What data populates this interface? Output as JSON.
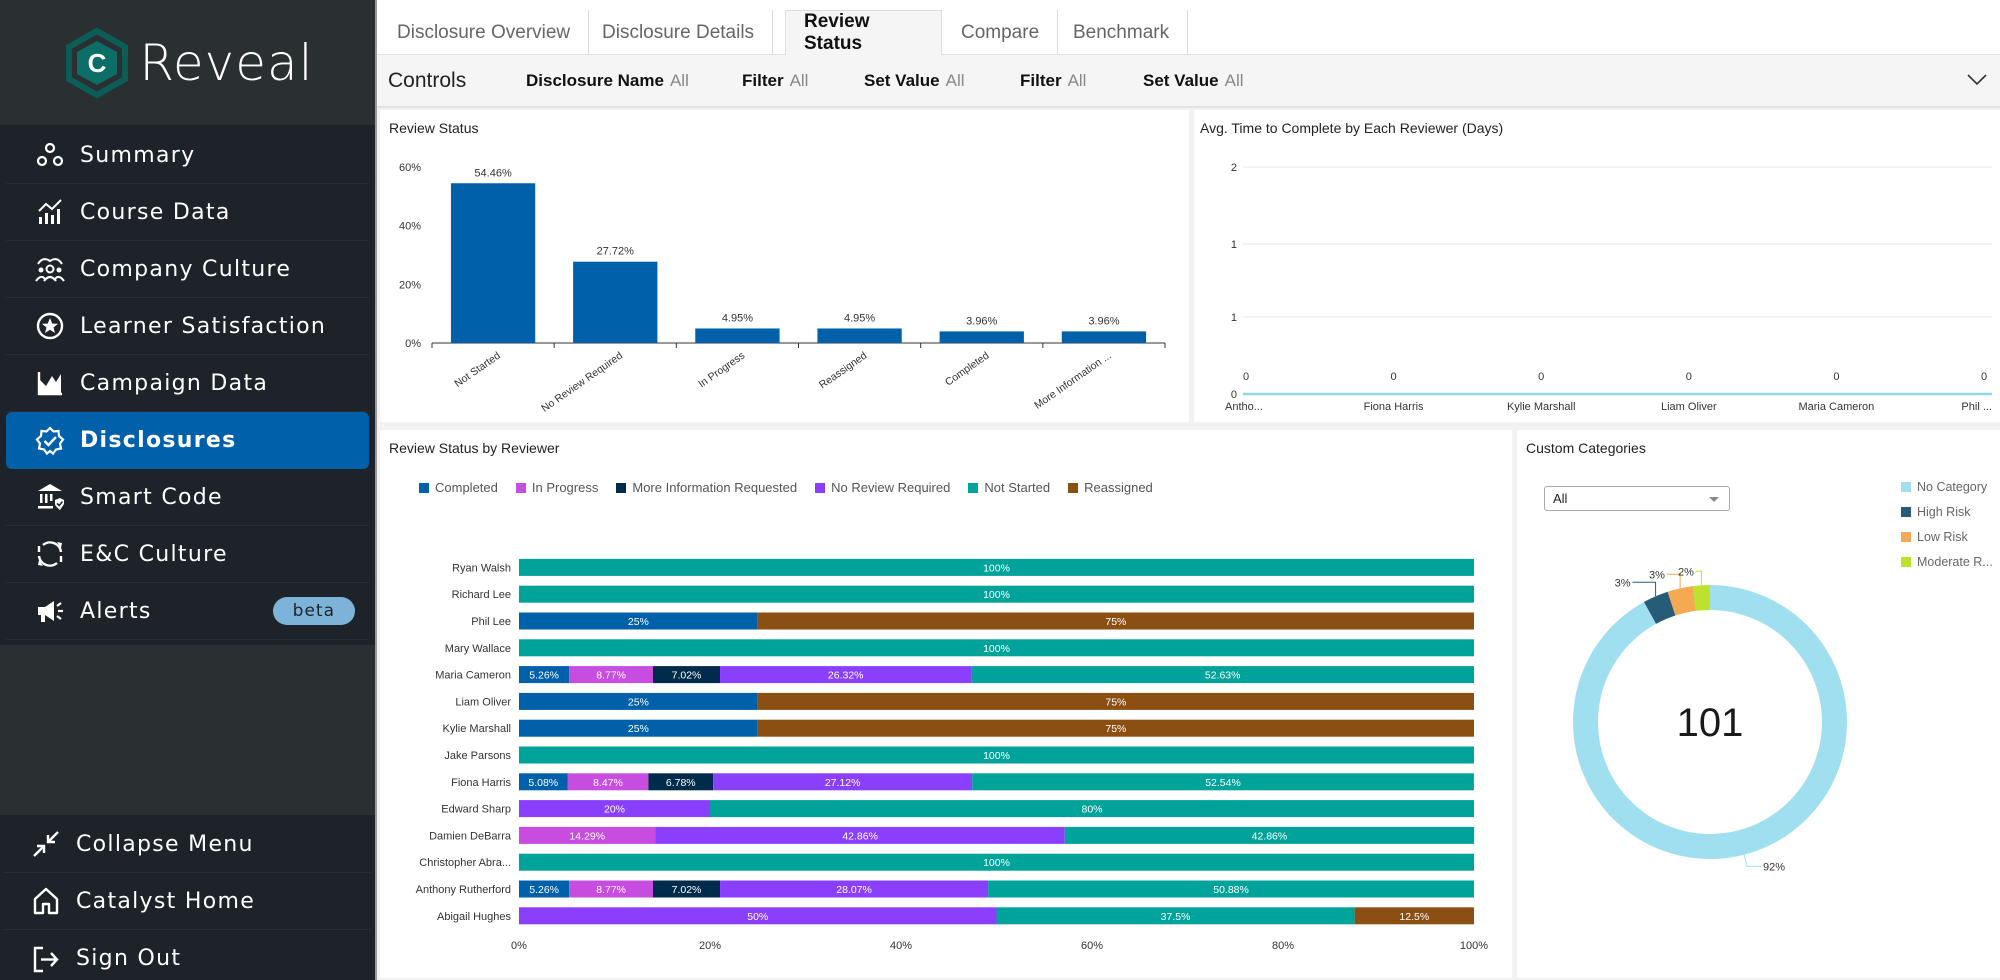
{
  "brand": {
    "logo_letter": "C",
    "name": "Reveal"
  },
  "sidebar": {
    "items": [
      {
        "label": "Summary",
        "icon": "circles-icon"
      },
      {
        "label": "Course Data",
        "icon": "bar-trend-icon"
      },
      {
        "label": "Company Culture",
        "icon": "people-group-icon"
      },
      {
        "label": "Learner Satisfaction",
        "icon": "star-circle-icon"
      },
      {
        "label": "Campaign Data",
        "icon": "area-chart-icon"
      },
      {
        "label": "Disclosures",
        "icon": "badge-check-icon",
        "active": true
      },
      {
        "label": "Smart Code",
        "icon": "bank-shield-icon"
      },
      {
        "label": "E&C Culture",
        "icon": "cycle-arrows-icon"
      },
      {
        "label": "Alerts",
        "icon": "megaphone-icon",
        "badge": "beta"
      }
    ],
    "bottom": [
      {
        "label": "Collapse Menu",
        "icon": "collapse-arrows-icon"
      },
      {
        "label": "Catalyst Home",
        "icon": "home-icon"
      },
      {
        "label": "Sign Out",
        "icon": "sign-out-icon"
      }
    ],
    "active_color": "#0060a9"
  },
  "tabs": [
    {
      "label": "Disclosure Overview"
    },
    {
      "label": "Disclosure Details"
    },
    {
      "label": "Review Status",
      "active": true
    },
    {
      "label": "Compare"
    },
    {
      "label": "Benchmark"
    }
  ],
  "controls": {
    "title": "Controls",
    "filters": [
      {
        "label": "Disclosure Name",
        "value": "All"
      },
      {
        "label": "Filter",
        "value": "All"
      },
      {
        "label": "Set Value",
        "value": "All"
      },
      {
        "label": "Filter",
        "value": "All"
      },
      {
        "label": "Set Value",
        "value": "All"
      }
    ]
  },
  "chart_data": [
    {
      "type": "bar",
      "title": "Review Status",
      "categories": [
        "Not Started",
        "No Review Required",
        "In Progress",
        "Reassigned",
        "Completed",
        "More Information ..."
      ],
      "values": [
        54.46,
        27.72,
        4.95,
        4.95,
        3.96,
        3.96
      ],
      "data_labels": [
        "54.46%",
        "27.72%",
        "4.95%",
        "4.95%",
        "3.96%",
        "3.96%"
      ],
      "yticks": [
        "0%",
        "20%",
        "40%",
        "60%"
      ],
      "ylim": [
        0,
        60
      ],
      "color": "#0060a9",
      "xlabel": "",
      "ylabel": ""
    },
    {
      "type": "line",
      "title": "Avg. Time to Complete by Each Reviewer (Days)",
      "categories": [
        "Antho...",
        "Fiona Harris",
        "Kylie Marshall",
        "Liam Oliver",
        "Maria Cameron",
        "Phil ..."
      ],
      "values": [
        0,
        0,
        0,
        0,
        0,
        0
      ],
      "data_labels": [
        "0",
        "0",
        "0",
        "0",
        "0",
        "0"
      ],
      "yticks": [
        "0",
        "1",
        "1",
        "2"
      ],
      "ylim": [
        0,
        2
      ],
      "color": "#8fd8e8",
      "grid": true
    },
    {
      "type": "bar",
      "orientation": "horizontal-stacked-100",
      "title": "Review Status by Reviewer",
      "legend": [
        {
          "name": "Completed",
          "color": "#0060a9"
        },
        {
          "name": "In Progress",
          "color": "#c74ce0"
        },
        {
          "name": "More Information Requested",
          "color": "#002b4a"
        },
        {
          "name": "No Review Required",
          "color": "#8a3ffc"
        },
        {
          "name": "Not Started",
          "color": "#00a39a"
        },
        {
          "name": "Reassigned",
          "color": "#8b4f12"
        }
      ],
      "legend_placement": "top",
      "xticks": [
        "0%",
        "20%",
        "40%",
        "60%",
        "80%",
        "100%"
      ],
      "xlim": [
        0,
        100
      ],
      "rows": [
        {
          "name": "Ryan Walsh",
          "segments": [
            {
              "series": "Not Started",
              "value": 100,
              "label": "100%"
            }
          ]
        },
        {
          "name": "Richard Lee",
          "segments": [
            {
              "series": "Not Started",
              "value": 100,
              "label": "100%"
            }
          ]
        },
        {
          "name": "Phil Lee",
          "segments": [
            {
              "series": "Completed",
              "value": 25,
              "label": "25%"
            },
            {
              "series": "Reassigned",
              "value": 75,
              "label": "75%"
            }
          ]
        },
        {
          "name": "Mary Wallace",
          "segments": [
            {
              "series": "Not Started",
              "value": 100,
              "label": "100%"
            }
          ]
        },
        {
          "name": "Maria Cameron",
          "segments": [
            {
              "series": "Completed",
              "value": 5.26,
              "label": "5.26%"
            },
            {
              "series": "In Progress",
              "value": 8.77,
              "label": "8.77%"
            },
            {
              "series": "More Information Requested",
              "value": 7.02,
              "label": "7.02%"
            },
            {
              "series": "No Review Required",
              "value": 26.32,
              "label": "26.32%"
            },
            {
              "series": "Not Started",
              "value": 52.63,
              "label": "52.63%"
            }
          ]
        },
        {
          "name": "Liam Oliver",
          "segments": [
            {
              "series": "Completed",
              "value": 25,
              "label": "25%"
            },
            {
              "series": "Reassigned",
              "value": 75,
              "label": "75%"
            }
          ]
        },
        {
          "name": "Kylie Marshall",
          "segments": [
            {
              "series": "Completed",
              "value": 25,
              "label": "25%"
            },
            {
              "series": "Reassigned",
              "value": 75,
              "label": "75%"
            }
          ]
        },
        {
          "name": "Jake Parsons",
          "segments": [
            {
              "series": "Not Started",
              "value": 100,
              "label": "100%"
            }
          ]
        },
        {
          "name": "Fiona Harris",
          "segments": [
            {
              "series": "Completed",
              "value": 5.08,
              "label": "5.08%"
            },
            {
              "series": "In Progress",
              "value": 8.47,
              "label": "8.47%"
            },
            {
              "series": "More Information Requested",
              "value": 6.78,
              "label": "6.78%"
            },
            {
              "series": "No Review Required",
              "value": 27.12,
              "label": "27.12%"
            },
            {
              "series": "Not Started",
              "value": 52.54,
              "label": "52.54%"
            }
          ]
        },
        {
          "name": "Edward Sharp",
          "segments": [
            {
              "series": "No Review Required",
              "value": 20,
              "label": "20%"
            },
            {
              "series": "Not Started",
              "value": 80,
              "label": "80%"
            }
          ]
        },
        {
          "name": "Damien DeBarra",
          "segments": [
            {
              "series": "In Progress",
              "value": 14.29,
              "label": "14.29%"
            },
            {
              "series": "No Review Required",
              "value": 42.86,
              "label": "42.86%"
            },
            {
              "series": "Not Started",
              "value": 42.86,
              "label": "42.86%"
            }
          ]
        },
        {
          "name": "Christopher Abra...",
          "segments": [
            {
              "series": "Not Started",
              "value": 100,
              "label": "100%"
            }
          ]
        },
        {
          "name": "Anthony Rutherford",
          "segments": [
            {
              "series": "Completed",
              "value": 5.26,
              "label": "5.26%"
            },
            {
              "series": "In Progress",
              "value": 8.77,
              "label": "8.77%"
            },
            {
              "series": "More Information Requested",
              "value": 7.02,
              "label": "7.02%"
            },
            {
              "series": "No Review Required",
              "value": 28.07,
              "label": "28.07%"
            },
            {
              "series": "Not Started",
              "value": 50.88,
              "label": "50.88%"
            }
          ]
        },
        {
          "name": "Abigail Hughes",
          "segments": [
            {
              "series": "No Review Required",
              "value": 50,
              "label": "50%"
            },
            {
              "series": "Not Started",
              "value": 37.5,
              "label": "37.5%"
            },
            {
              "series": "Reassigned",
              "value": 12.5,
              "label": "12.5%"
            }
          ]
        }
      ]
    },
    {
      "type": "pie",
      "variant": "donut",
      "title": "Custom Categories",
      "center_label": "101",
      "slices": [
        {
          "name": "No Category",
          "value": 92,
          "label": "92%",
          "color": "#a0dff0"
        },
        {
          "name": "High Risk",
          "value": 3,
          "label": "3%",
          "color": "#265c78"
        },
        {
          "name": "Low Risk",
          "value": 3,
          "label": "3%",
          "color": "#f5a952"
        },
        {
          "name": "Moderate R...",
          "value": 2,
          "label": "2%",
          "color": "#bde22e"
        }
      ],
      "legend_placement": "right",
      "filter": {
        "selected": "All"
      }
    }
  ]
}
